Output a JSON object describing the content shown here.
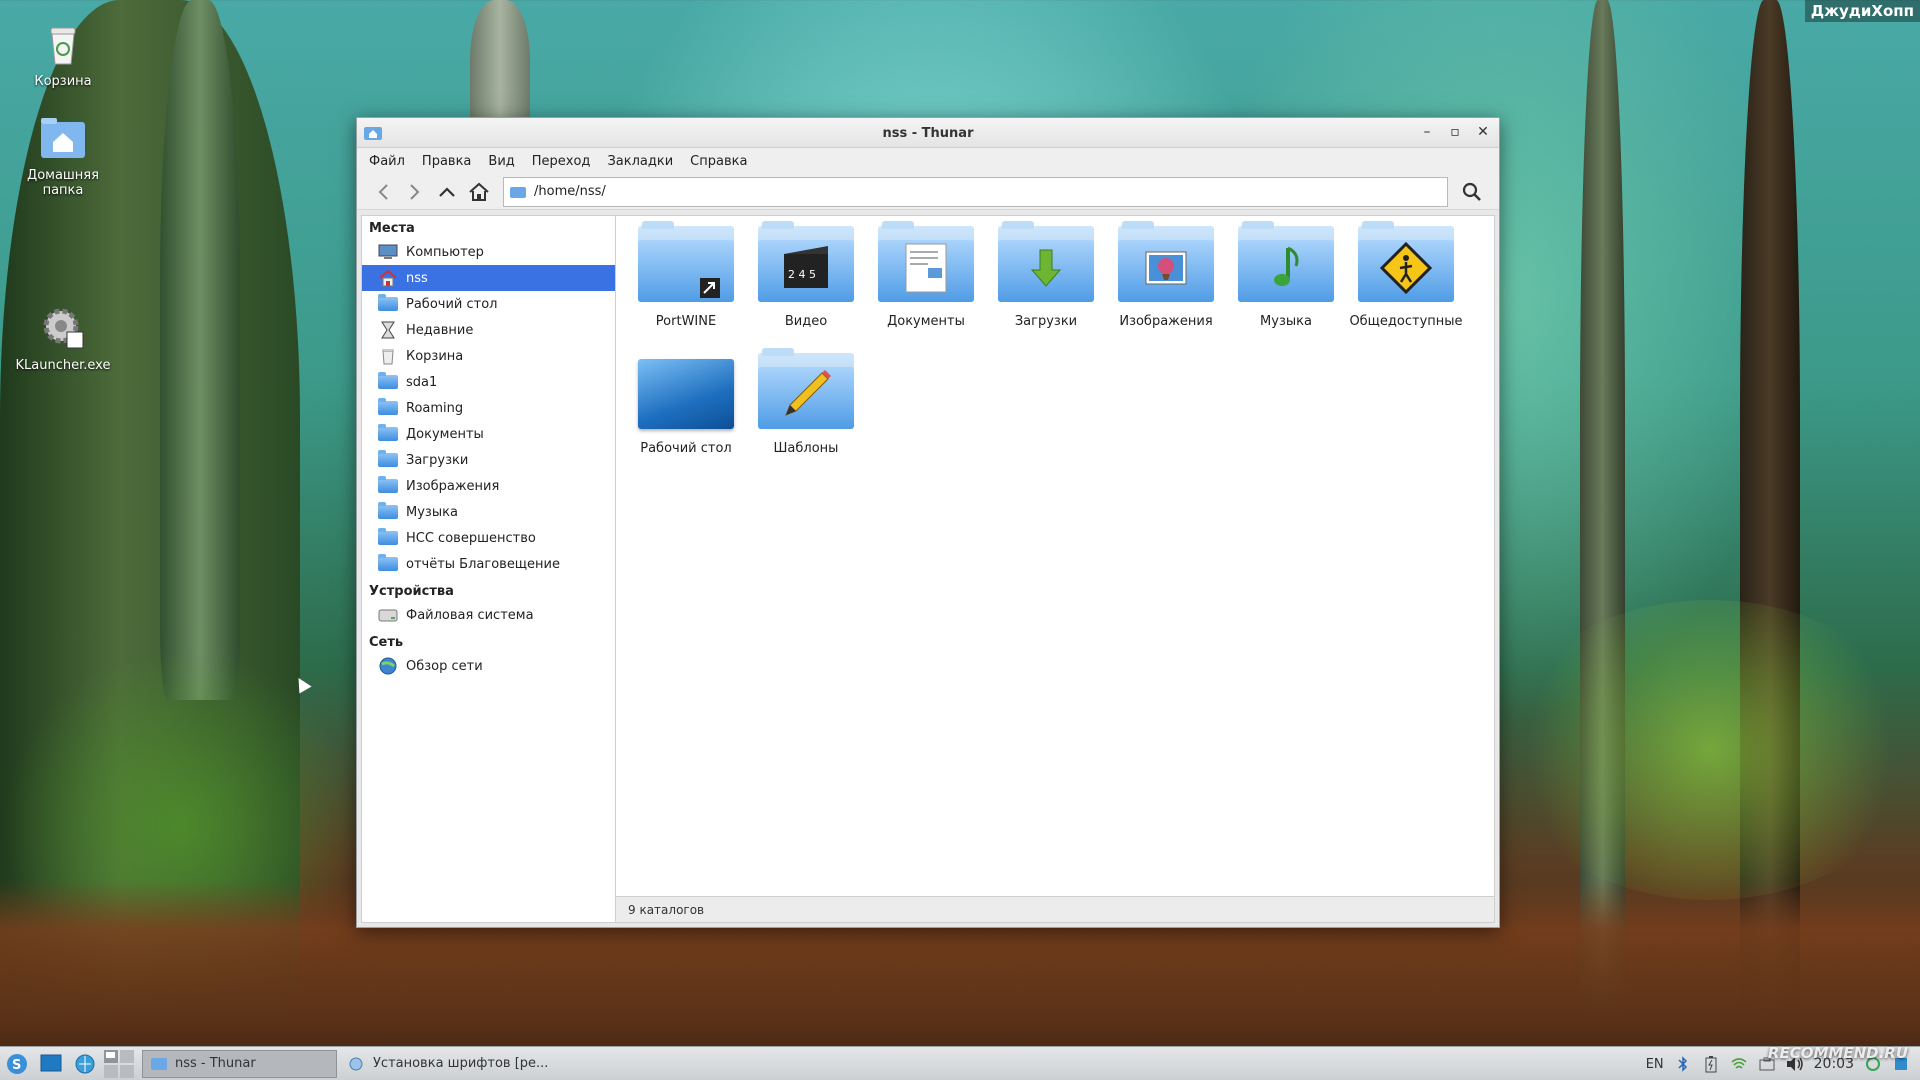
{
  "desktop": {
    "icons": [
      {
        "label": "Корзина"
      },
      {
        "label": "Домашняя папка"
      },
      {
        "label": "KLauncher.exe"
      }
    ],
    "corner_text": "ДжудиХопп",
    "watermark": "RECOMMEND.RU"
  },
  "window": {
    "title": "nss - Thunar",
    "controls": {
      "minimize": "–",
      "maximize": "▫",
      "close": "✕"
    },
    "menu": [
      "Файл",
      "Правка",
      "Вид",
      "Переход",
      "Закладки",
      "Справка"
    ],
    "path": "/home/nss/",
    "sidebar": {
      "places_title": "Места",
      "places": [
        {
          "label": "Компьютер",
          "icon": "computer-icon"
        },
        {
          "label": "nss",
          "icon": "home-icon",
          "selected": true
        },
        {
          "label": "Рабочий стол",
          "icon": "desktop-folder-icon"
        },
        {
          "label": "Недавние",
          "icon": "recent-icon"
        },
        {
          "label": "Корзина",
          "icon": "trash-icon"
        },
        {
          "label": "sda1",
          "icon": "folder-icon"
        },
        {
          "label": "Roaming",
          "icon": "folder-icon"
        },
        {
          "label": "Документы",
          "icon": "documents-folder-icon"
        },
        {
          "label": "Загрузки",
          "icon": "downloads-folder-icon"
        },
        {
          "label": "Изображения",
          "icon": "pictures-folder-icon"
        },
        {
          "label": "Музыка",
          "icon": "music-folder-icon"
        },
        {
          "label": "НСС совершенство",
          "icon": "folder-icon"
        },
        {
          "label": "отчёты Благовещение",
          "icon": "folder-icon"
        }
      ],
      "devices_title": "Устройства",
      "devices": [
        {
          "label": "Файловая система",
          "icon": "drive-icon"
        }
      ],
      "network_title": "Сеть",
      "network": [
        {
          "label": "Обзор сети",
          "icon": "network-icon"
        }
      ]
    },
    "files": [
      {
        "label": "PortWINE",
        "icon": "symlink-folder-icon"
      },
      {
        "label": "Видео",
        "icon": "video-folder-icon"
      },
      {
        "label": "Документы",
        "icon": "documents-folder-icon"
      },
      {
        "label": "Загрузки",
        "icon": "downloads-folder-icon"
      },
      {
        "label": "Изображения",
        "icon": "pictures-folder-icon"
      },
      {
        "label": "Музыка",
        "icon": "music-folder-icon"
      },
      {
        "label": "Общедоступные",
        "icon": "public-folder-icon"
      },
      {
        "label": "Рабочий стол",
        "icon": "desktop-folder-icon"
      },
      {
        "label": "Шаблоны",
        "icon": "templates-folder-icon"
      }
    ],
    "status": "9 каталогов"
  },
  "taskbar": {
    "tasks": [
      {
        "label": "nss - Thunar",
        "active": true
      },
      {
        "label": "Установка шрифтов [ре...",
        "active": false
      }
    ],
    "layout": "EN",
    "clock": "20:03"
  },
  "colors": {
    "selection": "#3b72e3",
    "folder": "#4f9ce6"
  }
}
